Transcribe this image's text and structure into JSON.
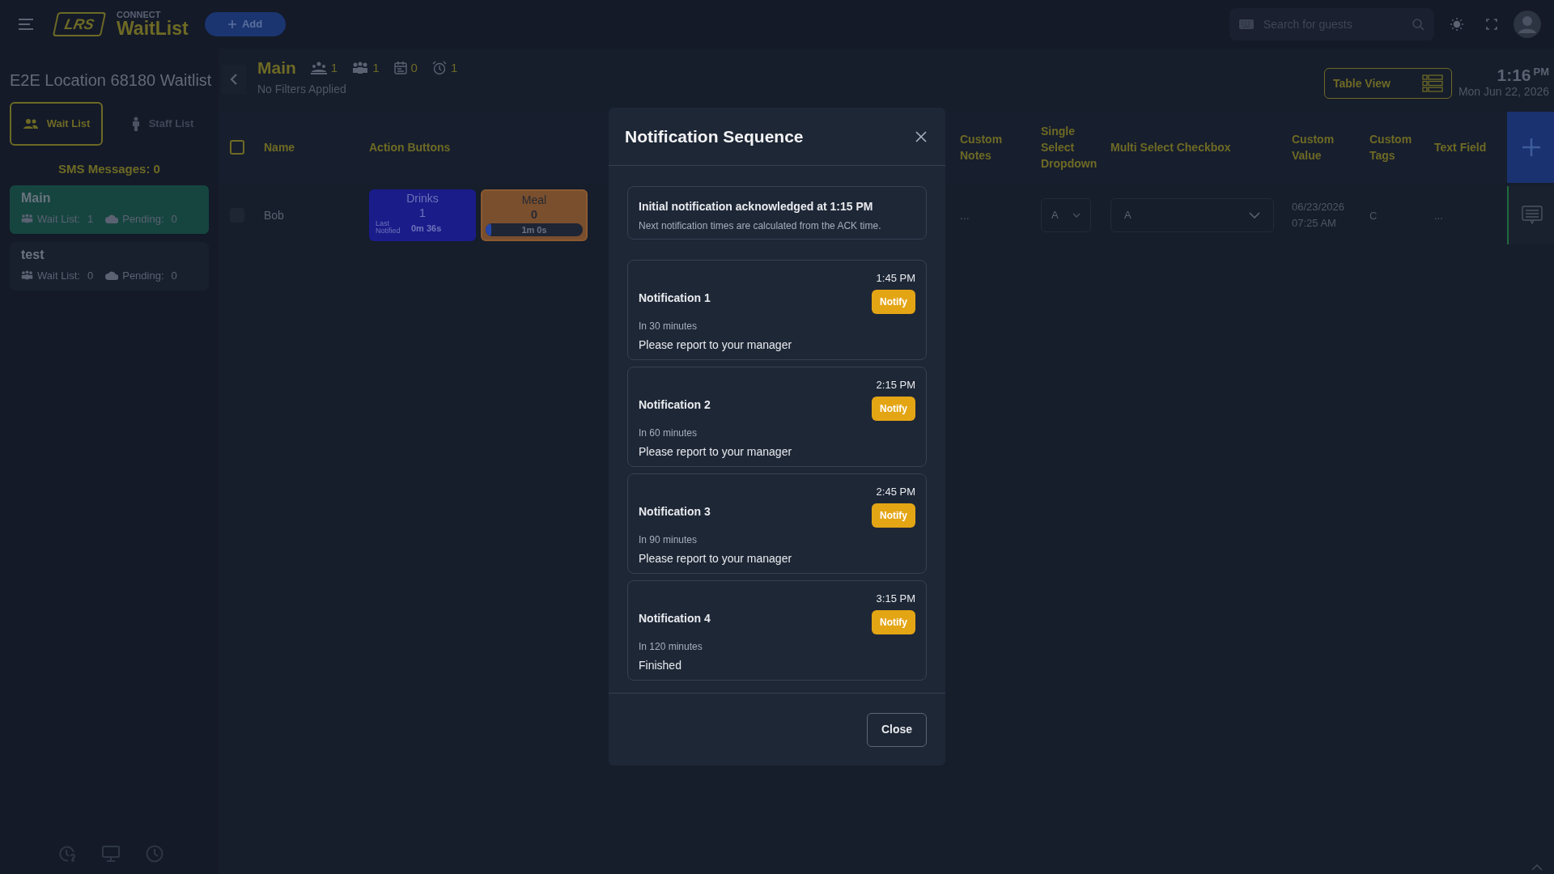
{
  "top_bar": {
    "brand_small": "CONNECT",
    "brand": "WaitList",
    "logo": "LRS",
    "add_button": "Add",
    "search": {
      "placeholder": "Search for guests"
    }
  },
  "sidebar": {
    "title": "E2E Location 68180 Waitlist",
    "tabs": [
      {
        "label": "Wait List",
        "kind": "group",
        "selected": true
      },
      {
        "label": "Staff List",
        "kind": "person",
        "selected": false
      }
    ],
    "sms": "SMS Messages: 0",
    "lists": [
      {
        "name": "Main",
        "selected": true,
        "wait_label": "Wait List:",
        "wait": "1",
        "pending_label": "Pending:",
        "pending": "0"
      },
      {
        "name": "test",
        "selected": false,
        "wait_label": "Wait List:",
        "wait": "0",
        "pending_label": "Pending:",
        "pending": "0"
      }
    ]
  },
  "header": {
    "title": "Main",
    "stats": [
      {
        "kind": "party",
        "value": "1"
      },
      {
        "kind": "group",
        "value": "1"
      },
      {
        "kind": "calendar",
        "value": "0"
      },
      {
        "kind": "alarm",
        "value": "1"
      }
    ],
    "filters": "No Filters Applied",
    "view_button": "Table View",
    "time": "1:16",
    "ampm": "PM",
    "date": "Mon Jun 22, 2026"
  },
  "table": {
    "all_checked": false,
    "columns": [
      "Name",
      "Action Buttons",
      "Custom Notes",
      "Single Select Dropdown",
      "Multi Select Checkbox",
      "Custom Value",
      "Custom Tags",
      "Text Field"
    ],
    "rows": [
      {
        "checked": false,
        "name": "Bob",
        "actions": [
          {
            "kind": "counter",
            "label": "Drinks",
            "count": "1",
            "note": "Last Notified",
            "time": "0m 36s"
          },
          {
            "kind": "timer",
            "label": "Meal",
            "count": "0",
            "time": "1m 0s",
            "level": 0.06
          }
        ],
        "notes": "...",
        "single": "A",
        "multi": "A",
        "custom_value": "06/23/2026 07:25 AM",
        "tags": "C",
        "text": "..."
      }
    ]
  },
  "modal": {
    "title": "Notification Sequence",
    "info": {
      "title": "Initial notification acknowledged at 1:15 PM",
      "text": "Next notification times are calculated from the ACK time."
    },
    "notifications": [
      {
        "title": "Notification 1",
        "time": "1:45 PM",
        "button": "Notify",
        "due": "In 30 minutes",
        "message": "Please report to your manager"
      },
      {
        "title": "Notification 2",
        "time": "2:15 PM",
        "button": "Notify",
        "due": "In 60 minutes",
        "message": "Please report to your manager"
      },
      {
        "title": "Notification 3",
        "time": "2:45 PM",
        "button": "Notify",
        "due": "In 90 minutes",
        "message": "Please report to your manager"
      },
      {
        "title": "Notification 4",
        "time": "3:15 PM",
        "button": "Notify",
        "due": "In 120 minutes",
        "message": "Finished"
      }
    ],
    "close_button": "Close"
  }
}
